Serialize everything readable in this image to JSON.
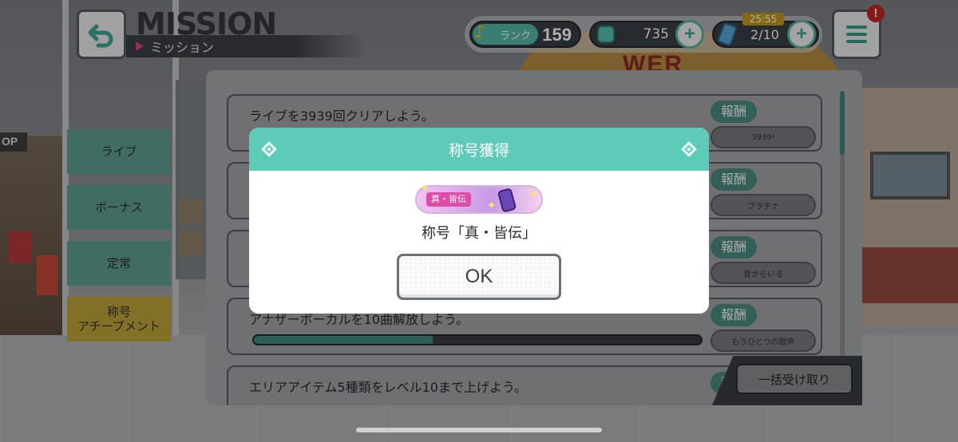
{
  "header": {
    "title": "MISSION",
    "subtitle": "ミッション",
    "rank_label": "ランク",
    "rank_value": "159",
    "gems": "735",
    "stamina_timer": "25:55",
    "stamina": "2/10",
    "alert": "!"
  },
  "sidebar": {
    "tabs": [
      {
        "label": "ライブ"
      },
      {
        "label": "ボーナス"
      },
      {
        "label": "定常"
      },
      {
        "label": "称号\nアチーブメント"
      }
    ]
  },
  "missions": [
    {
      "text": "ライブを3939回クリアしよう。",
      "reward_label": "報酬",
      "reward_item": "3939!"
    },
    {
      "text": "",
      "reward_label": "報酬",
      "reward_item": "プラチナ"
    },
    {
      "text": "",
      "reward_label": "報酬",
      "reward_item": "昔からいる"
    },
    {
      "text": "アナザーボーカルを10曲解放しよう。",
      "reward_label": "報酬",
      "reward_item": "もうひとつの歌声",
      "progress": 0.4
    },
    {
      "text": "エリアアイテム5種類をレベル10まで上げよう。",
      "reward_label": "報酬",
      "reward_item": ""
    }
  ],
  "bulk_claim_label": "一括受け取り",
  "modal": {
    "title": "称号獲得",
    "badge_tag": "真・皆伝",
    "name": "称号「真・皆伝」",
    "ok_label": "OK"
  },
  "colors": {
    "accent_teal": "#5ecab8",
    "active_tab_yellow": "#c2a63a",
    "alert_red": "#c42424",
    "timer_gold": "#c59a1c"
  }
}
